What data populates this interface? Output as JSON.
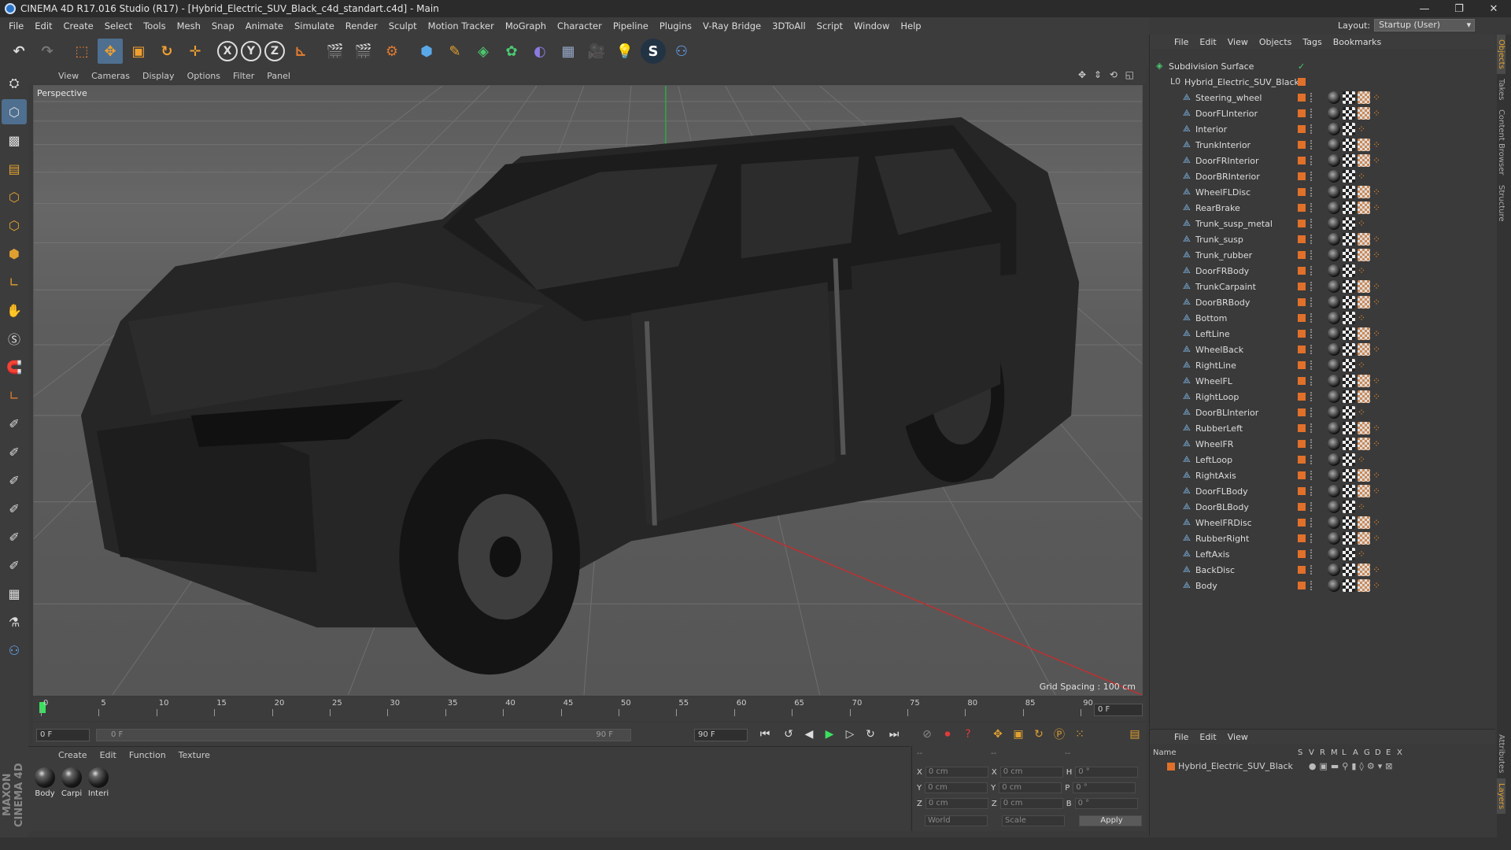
{
  "window": {
    "title": "CINEMA 4D R17.016 Studio (R17) - [Hybrid_Electric_SUV_Black_c4d_standart.c4d] - Main",
    "controls": [
      "—",
      "❐",
      "✕"
    ]
  },
  "menu": [
    "File",
    "Edit",
    "Create",
    "Select",
    "Tools",
    "Mesh",
    "Snap",
    "Animate",
    "Simulate",
    "Render",
    "Sculpt",
    "Motion Tracker",
    "MoGraph",
    "Character",
    "Pipeline",
    "Plugins",
    "V-Ray Bridge",
    "3DToAll",
    "Script",
    "Window",
    "Help"
  ],
  "layout": {
    "label": "Layout:",
    "value": "Startup (User)"
  },
  "toolbar": {
    "icons": [
      "undo-icon",
      "redo-icon",
      "select-icon",
      "move-icon",
      "scale-icon",
      "rotate-icon",
      "transform-icon",
      "x-axis-icon",
      "y-axis-icon",
      "z-axis-icon",
      "coordinate-icon",
      "render-view-icon",
      "render-pv-icon",
      "render-settings-icon",
      "cube-icon",
      "pen-icon",
      "subdivide-icon",
      "array-icon",
      "deformer-icon",
      "floor-icon",
      "camera-icon",
      "light-icon",
      "vray-icon",
      "python-icon"
    ],
    "axis_labels": [
      "X",
      "Y",
      "Z"
    ]
  },
  "viewport": {
    "menu": [
      "View",
      "Cameras",
      "Display",
      "Options",
      "Filter",
      "Panel"
    ],
    "label": "Perspective",
    "grid_spacing": "Grid Spacing : 100 cm",
    "nav": "✥ ⇕ ⟲ ◱"
  },
  "timeline": {
    "ticks": [
      "0",
      "5",
      "10",
      "15",
      "20",
      "25",
      "30",
      "35",
      "40",
      "45",
      "50",
      "55",
      "60",
      "65",
      "70",
      "75",
      "80",
      "85",
      "90"
    ],
    "current": "0 F",
    "start": "0 F",
    "range_start": "0 F",
    "range_end": "90 F",
    "end": "90 F",
    "current_right": "0 F"
  },
  "materials": {
    "menu": [
      "Create",
      "Edit",
      "Function",
      "Texture"
    ],
    "items": [
      "Body",
      "Carpi",
      "Interi"
    ]
  },
  "coords": {
    "headers": [
      "--",
      "--",
      "--"
    ],
    "rows": [
      {
        "a": "X",
        "v1": "0 cm",
        "b": "X",
        "v2": "0 cm",
        "c": "H",
        "v3": "0 °"
      },
      {
        "a": "Y",
        "v1": "0 cm",
        "b": "Y",
        "v2": "0 cm",
        "c": "P",
        "v3": "0 °"
      },
      {
        "a": "Z",
        "v1": "0 cm",
        "b": "Z",
        "v2": "0 cm",
        "c": "B",
        "v3": "0 °"
      }
    ],
    "world": "World",
    "scale": "Scale",
    "apply": "Apply"
  },
  "objects": {
    "menu": [
      "File",
      "Edit",
      "View",
      "Objects",
      "Tags",
      "Bookmarks"
    ],
    "root": "Subdivision Surface",
    "parent": "Hybrid_Electric_SUV_Black",
    "children": [
      "Steering_wheel",
      "DoorFLInterior",
      "Interior",
      "TrunkInterior",
      "DoorFRInterior",
      "DoorBRInterior",
      "WheelFLDisc",
      "RearBrake",
      "Trunk_susp_metal",
      "Trunk_susp",
      "Trunk_rubber",
      "DoorFRBody",
      "TrunkCarpaint",
      "DoorBRBody",
      "Bottom",
      "LeftLine",
      "WheelBack",
      "RightLine",
      "WheelFL",
      "RightLoop",
      "DoorBLInterior",
      "RubberLeft",
      "WheelFR",
      "LeftLoop",
      "RightAxis",
      "DoorFLBody",
      "DoorBLBody",
      "WheelFRDisc",
      "RubberRight",
      "LeftAxis",
      "BackDisc",
      "Body"
    ]
  },
  "attributes": {
    "menu": [
      "File",
      "Edit",
      "View"
    ],
    "columns": [
      "Name",
      "S",
      "V",
      "R",
      "M",
      "L",
      "A",
      "G",
      "D",
      "E",
      "X"
    ],
    "row": "Hybrid_Electric_SUV_Black"
  },
  "side_tabs": [
    "Objects",
    "Takes",
    "Content Browser",
    "Structure",
    "Attributes",
    "Layers"
  ],
  "brand": "MAXON CINEMA 4D"
}
